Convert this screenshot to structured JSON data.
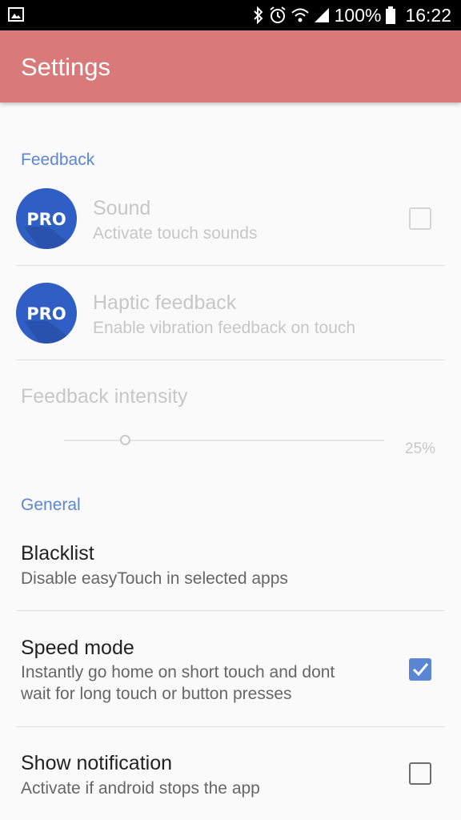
{
  "status_bar": {
    "battery_percent": "100%",
    "time": "16:22",
    "icons": [
      "gallery-icon",
      "bluetooth-icon",
      "alarm-icon",
      "wifi-icon",
      "signal-icon",
      "battery-icon"
    ]
  },
  "app_bar": {
    "title": "Settings"
  },
  "sections": {
    "feedback": {
      "header": "Feedback",
      "sound": {
        "badge": "PRO",
        "title": "Sound",
        "summary": "Activate touch sounds",
        "checked": false,
        "enabled": false
      },
      "haptic": {
        "badge": "PRO",
        "title": "Haptic feedback",
        "summary": "Enable vibration feedback on touch",
        "enabled": false
      },
      "intensity": {
        "title": "Feedback intensity",
        "value_label": "25%",
        "value": 0.25,
        "enabled": false
      }
    },
    "general": {
      "header": "General",
      "blacklist": {
        "title": "Blacklist",
        "summary": "Disable easyTouch in selected apps"
      },
      "speed_mode": {
        "title": "Speed mode",
        "summary_line1": "Instantly go home on short touch and dont",
        "summary_line2": "wait for long touch or button presses",
        "checked": true
      },
      "show_notification": {
        "title": "Show notification",
        "summary": "Activate if android stops the app",
        "checked": false
      }
    }
  },
  "colors": {
    "app_bar": "#d9797a",
    "accent": "#5b86d4",
    "pro_badge": "#2f5fc4"
  }
}
